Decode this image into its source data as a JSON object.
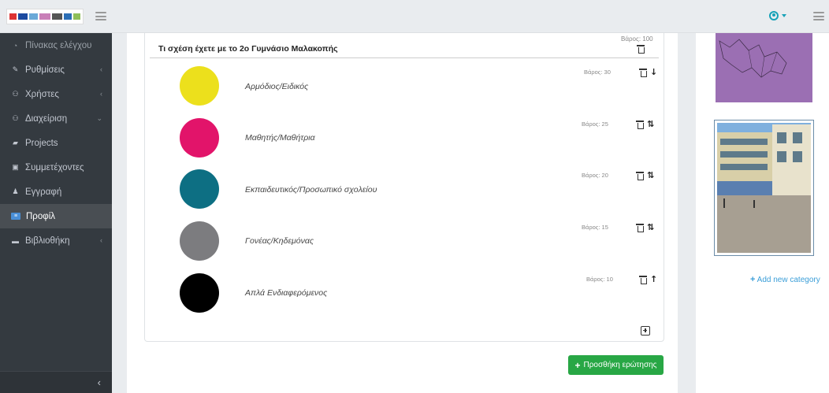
{
  "sidebar": {
    "items": [
      {
        "label": "Πίνακας ελέγχου",
        "icon": "gauge-icon",
        "state": "dim",
        "has_children": false
      },
      {
        "label": "Ρυθμίσεις",
        "icon": "wrench-icon",
        "state": "normal",
        "has_children": true
      },
      {
        "label": "Χρήστες",
        "icon": "users-icon",
        "state": "normal",
        "has_children": true
      },
      {
        "label": "Διαχείριση",
        "icon": "users-cog-icon",
        "state": "normal",
        "has_children": true
      },
      {
        "label": "Projects",
        "icon": "folder-icon",
        "state": "normal",
        "has_children": false
      },
      {
        "label": "Συμμετέχοντες",
        "icon": "id-card-icon",
        "state": "normal",
        "has_children": false
      },
      {
        "label": "Εγγραφή",
        "icon": "user-plus-icon",
        "state": "normal",
        "has_children": false
      },
      {
        "label": "Προφίλ",
        "icon": "profile-card-icon",
        "state": "active",
        "has_children": false
      },
      {
        "label": "Βιβλιοθήκη",
        "icon": "library-icon",
        "state": "normal",
        "has_children": true
      }
    ],
    "collapse_glyph": "‹"
  },
  "question": {
    "title": "Τι σχέση έχετε με το 2ο Γυμνάσιο Μαλακοπής",
    "weight": "Βάρος: 100",
    "options": [
      {
        "label": "Αρμόδιος/Ειδικός",
        "weight": "Βάρος: 30",
        "color": "#ece01c",
        "arrows": "↓"
      },
      {
        "label": "Μαθητής/Μαθήτρια",
        "weight": "Βάρος: 25",
        "color": "#e2146a",
        "arrows": "⇅"
      },
      {
        "label": "Εκπαιδευτικός/Προσωπικό σχολείου",
        "weight": "Βάρος: 20",
        "color": "#0d6f83",
        "arrows": "⇅"
      },
      {
        "label": "Γονέας/Κηδεμόνας",
        "weight": "Βάρος: 15",
        "color": "#7c7c7f",
        "arrows": "⇅"
      },
      {
        "label": "Απλά Ενδιαφερόμενος",
        "weight": "Βάρος: 10",
        "color": "#000000",
        "arrows": "↑"
      }
    ]
  },
  "buttons": {
    "add_question": "Προσθήκη ερώτησης",
    "add_category": "Add new category",
    "plus_glyph": "+"
  },
  "colors": {
    "sidebar_bg": "#343a40",
    "success": "#28a745",
    "link": "#3b9ed8",
    "user_icon": "#17a2b8",
    "map_fill": "#9b6fb3"
  }
}
